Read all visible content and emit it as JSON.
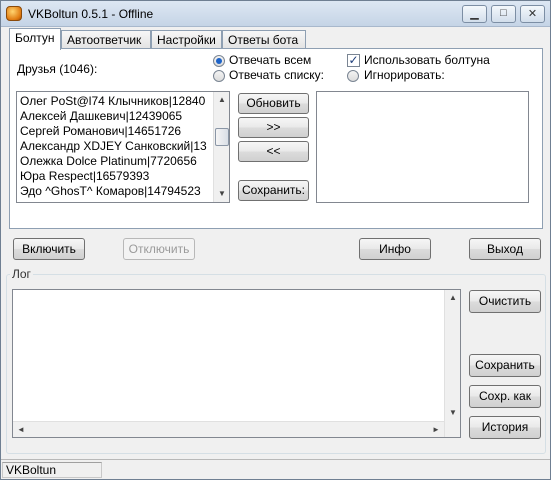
{
  "window": {
    "title": "VKBoltun 0.5.1 - Offline",
    "minimize_glyph": "▁",
    "maximize_glyph": "□",
    "close_glyph": "✕"
  },
  "tabs": [
    "Болтун",
    "Автоответчик",
    "Настройки",
    "Ответы бота"
  ],
  "friends": {
    "label": "Друзья (1046):",
    "items": [
      "Олег PoSt@l74 Клычников|12840",
      "Алексей Дашкевич|12439065",
      "Сергей Романович|14651726",
      "Александр XDJEY Санковский|13",
      "Олежка Dolce Platinum|7720656",
      "Юра Respect|16579393",
      "Эдо ^GhosT^ Комаров|14794523"
    ]
  },
  "reply_mode": {
    "all_label": "Отвечать всем",
    "list_label": "Отвечать списку:",
    "selected": "all"
  },
  "options": {
    "use_boltun_label": "Использовать болтуна",
    "use_boltun_checked": true,
    "check_glyph": "✓",
    "ignore_label": "Игнорировать:"
  },
  "middle_buttons": {
    "refresh": "Обновить",
    "add": ">>",
    "remove": "<<",
    "save": "Сохранить:"
  },
  "main_buttons": {
    "enable": "Включить",
    "disable": "Отключить",
    "info": "Инфо",
    "exit": "Выход"
  },
  "log": {
    "title": "Лог",
    "clear": "Очистить",
    "save": "Сохранить",
    "save_as": "Сохр. как",
    "history": "История"
  },
  "scroll_glyphs": {
    "up": "▲",
    "down": "▼",
    "left": "◄",
    "right": "►"
  },
  "statusbar": {
    "text": "VKBoltun"
  }
}
